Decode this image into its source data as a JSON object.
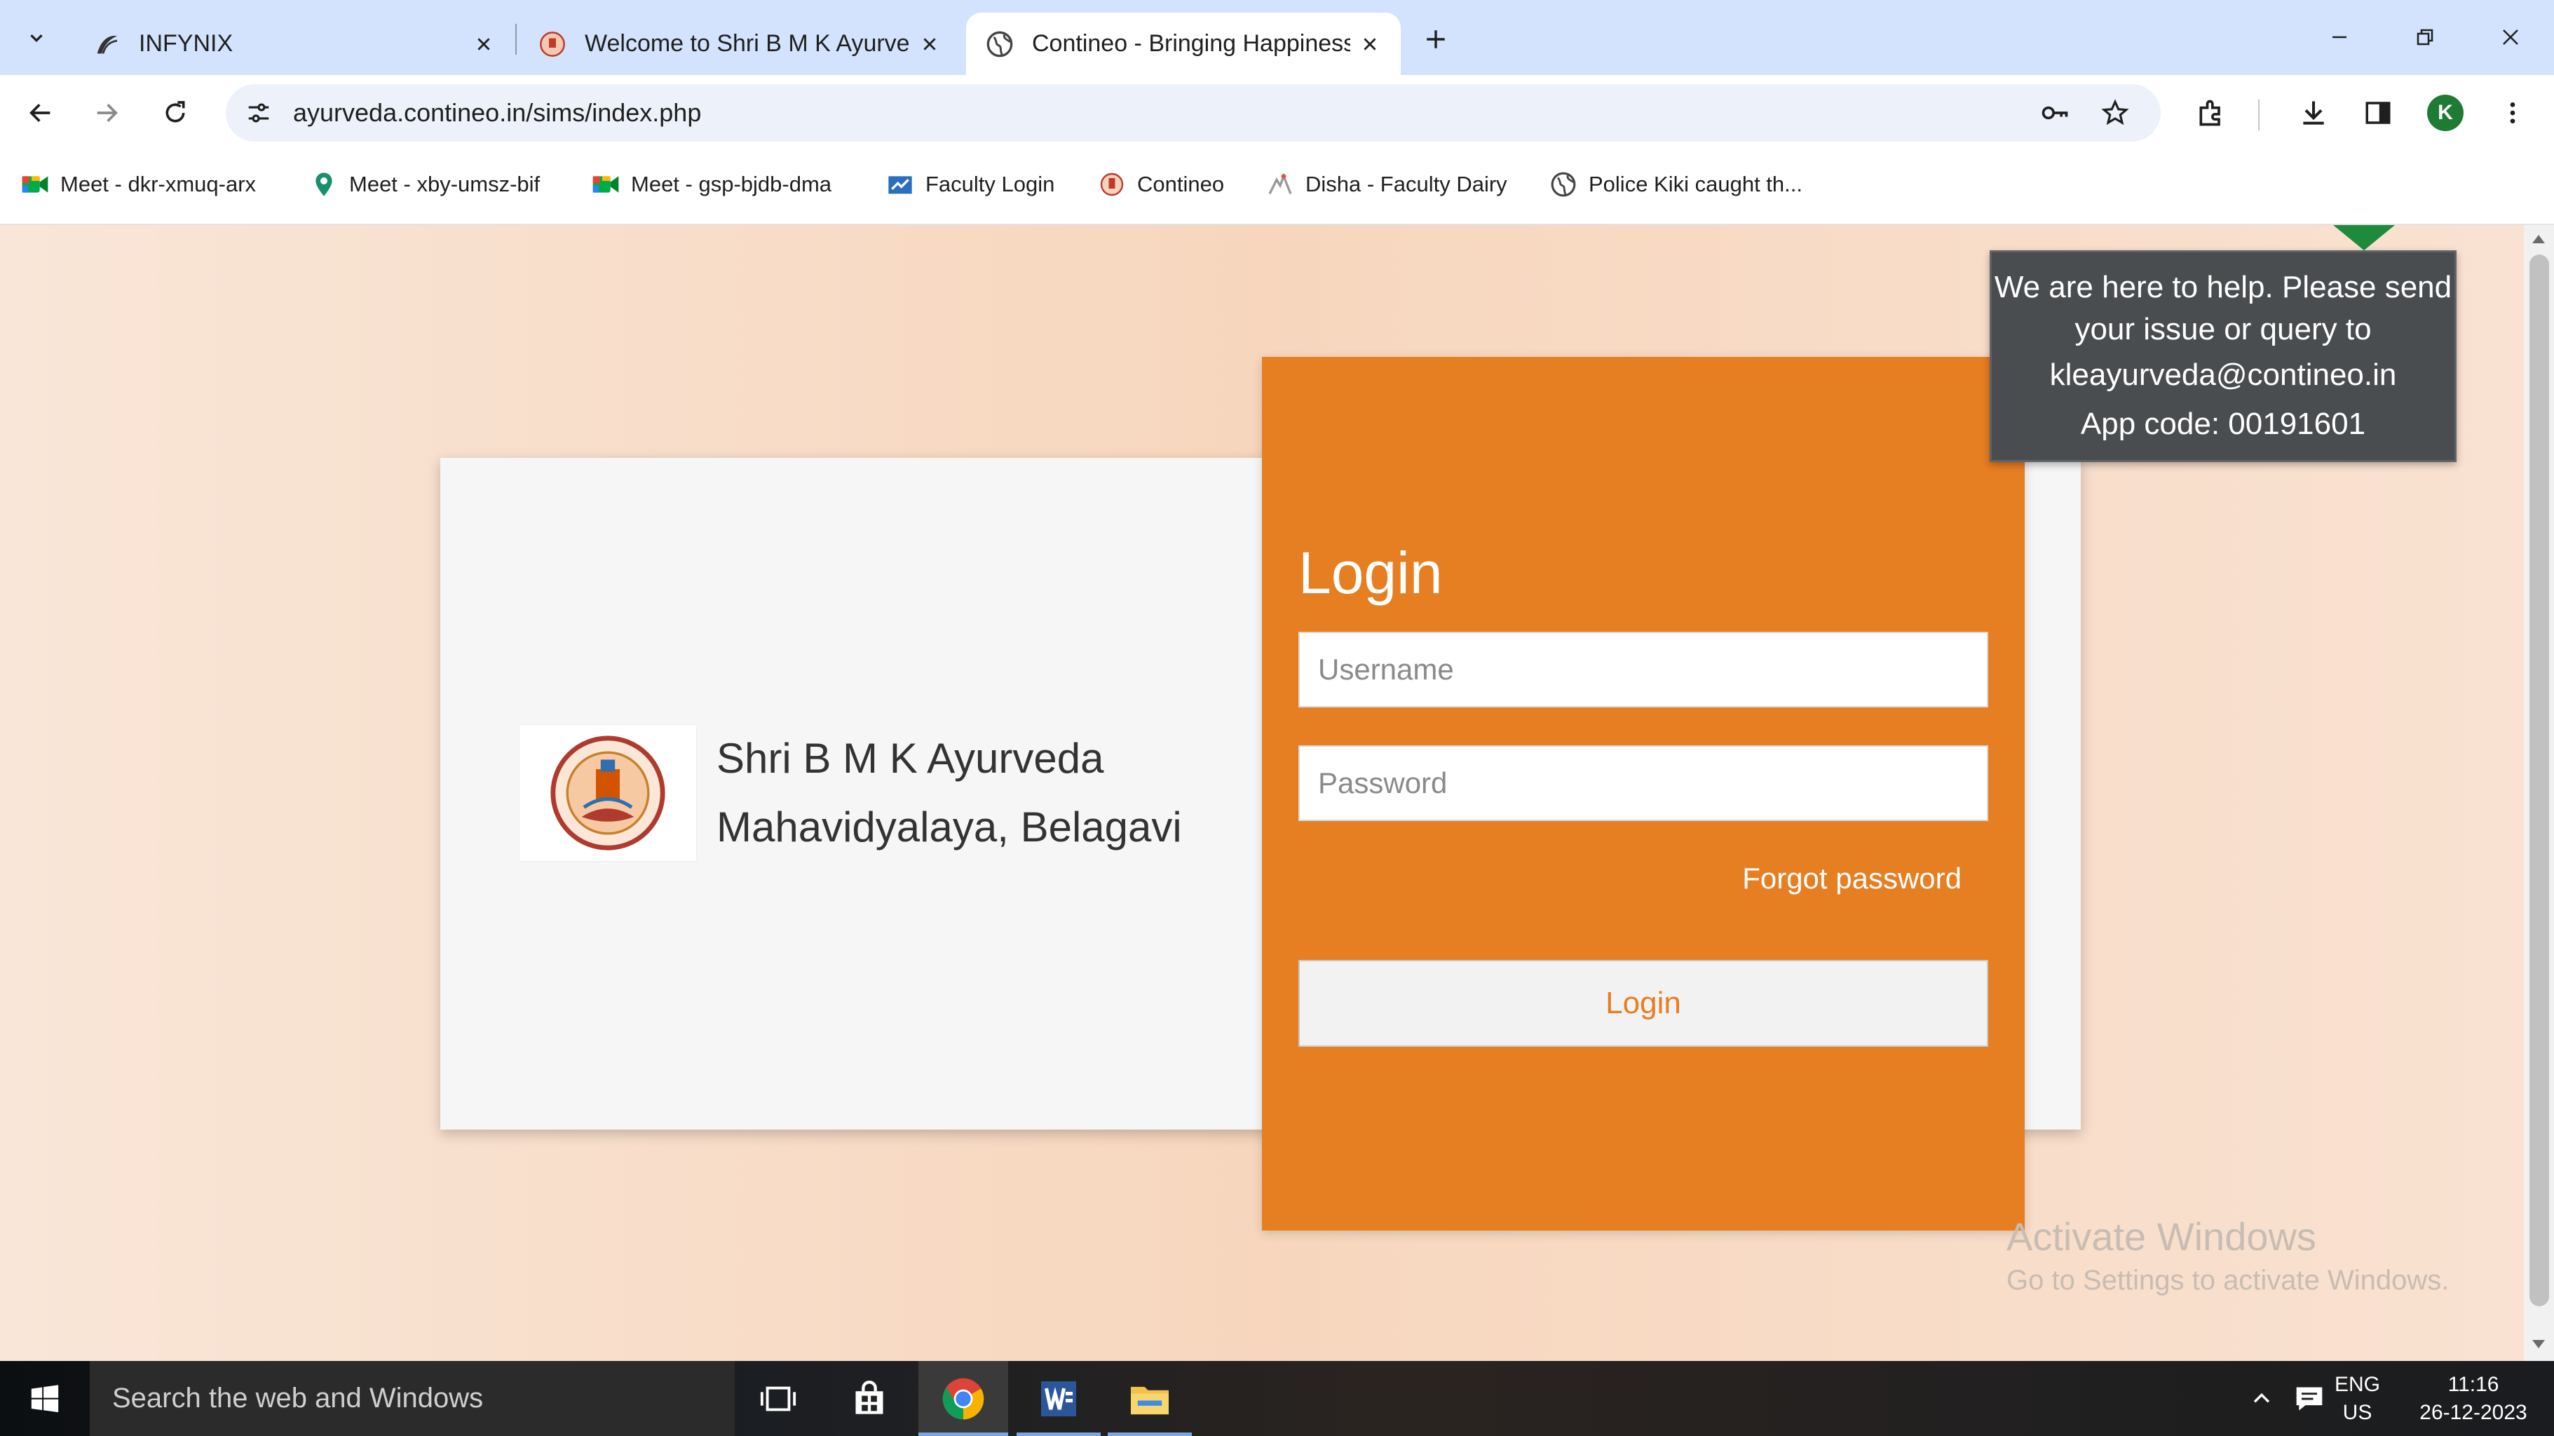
{
  "browser": {
    "tabs": [
      {
        "title": "INFYNIX",
        "active": false
      },
      {
        "title": "Welcome to Shri B M K Ayurved",
        "active": false
      },
      {
        "title": "Contineo - Bringing Happiness",
        "active": true
      }
    ],
    "url": "ayurveda.contineo.in/sims/index.php",
    "profile_initial": "K"
  },
  "bookmarks": [
    {
      "label": "Meet - dkr-xmuq-arx",
      "icon": "google-meet-icon"
    },
    {
      "label": "Meet - xby-umsz-bif",
      "icon": "location-pin-icon"
    },
    {
      "label": "Meet - gsp-bjdb-dma",
      "icon": "google-meet-icon"
    },
    {
      "label": "Faculty Login",
      "icon": "faculty-icon"
    },
    {
      "label": "Contineo",
      "icon": "contineo-icon"
    },
    {
      "label": "Disha - Faculty Dairy",
      "icon": "disha-icon"
    },
    {
      "label": "Police Kiki caught th...",
      "icon": "globe-icon"
    }
  ],
  "page": {
    "college_line1": "Shri B M K Ayurveda",
    "college_line2": "Mahavidyalaya, Belagavi",
    "login_title": "Login",
    "username_placeholder": "Username",
    "password_placeholder": "Password",
    "forgot_password": "Forgot password",
    "login_button": "Login",
    "help": {
      "line1": "We are here to help. Please send",
      "line2": "your issue or query to",
      "email": "kleayurveda@contineo.in",
      "app_code": "App code: 00191601"
    },
    "watermark": {
      "line1": "Activate Windows",
      "line2": "Go to Settings to activate Windows."
    }
  },
  "taskbar": {
    "search_placeholder": "Search the web and Windows",
    "lang": "ENG",
    "region": "US",
    "time": "11:16",
    "date": "26-12-2023"
  },
  "colors": {
    "accent_orange": "#e67e22",
    "chrome_tab_strip": "#d3e3fd",
    "help_bg": "#4a4d50"
  }
}
